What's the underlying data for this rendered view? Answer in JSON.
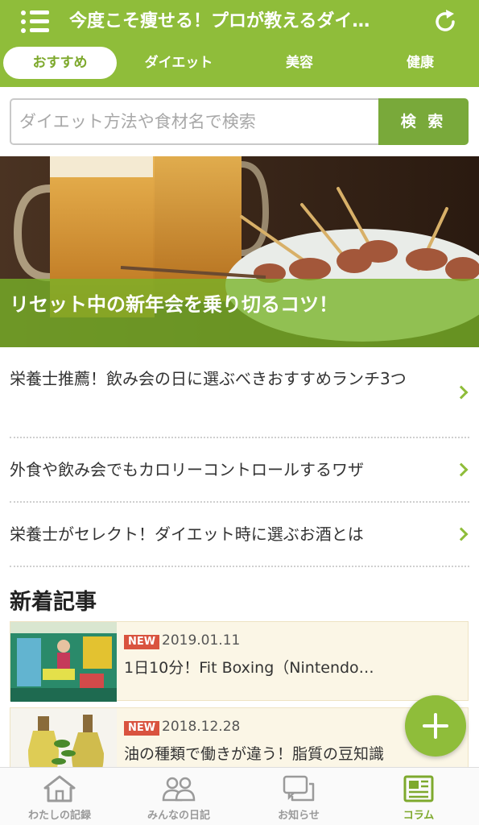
{
  "header": {
    "title": "今度こそ痩せる！プロが教えるダイ…"
  },
  "tabs": [
    {
      "label": "おすすめ",
      "active": true
    },
    {
      "label": "ダイエット",
      "active": false
    },
    {
      "label": "美容",
      "active": false
    },
    {
      "label": "健康",
      "active": false
    }
  ],
  "search": {
    "placeholder": "ダイエット方法や食材名で検索",
    "button_label": "検 索"
  },
  "hero": {
    "caption": "リセット中の新年会を乗り切るコツ！"
  },
  "featured": [
    {
      "label": "栄養士推薦！飲み会の日に選ぶべきおすすめランチ3つ"
    },
    {
      "label": "外食や飲み会でもカロリーコントロールするワザ"
    },
    {
      "label": "栄養士がセレクト！ダイエット時に選ぶお酒とは"
    }
  ],
  "new_articles": {
    "title": "新着記事",
    "items": [
      {
        "badge": "NEW",
        "date": "2019.01.11",
        "title": "1日10分！Fit Boxing（Nintendo…"
      },
      {
        "badge": "NEW",
        "date": "2018.12.28",
        "title": "油の種類で働きが違う！脂質の豆知識"
      }
    ]
  },
  "bottom_nav": [
    {
      "label": "わたしの記録",
      "icon": "house-icon",
      "active": false
    },
    {
      "label": "みんなの日記",
      "icon": "people-icon",
      "active": false
    },
    {
      "label": "お知らせ",
      "icon": "speech-bubble-icon",
      "active": false
    },
    {
      "label": "コラム",
      "icon": "newspaper-icon",
      "active": true
    }
  ],
  "colors": {
    "brand_green": "#8fbd3a",
    "search_button": "#79a93a",
    "new_badge": "#d9533f",
    "article_bg": "#fbf6e6"
  }
}
